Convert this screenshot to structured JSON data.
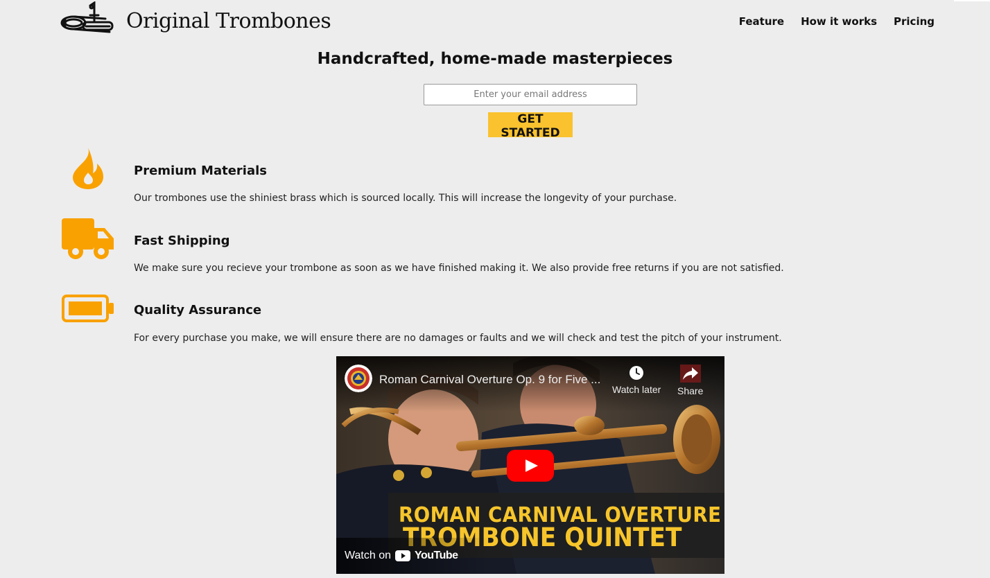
{
  "header": {
    "logo_text": "Original Trombones",
    "nav": [
      {
        "label": "Feature"
      },
      {
        "label": "How it works"
      },
      {
        "label": "Pricing"
      }
    ]
  },
  "hero": {
    "title": "Handcrafted, home-made masterpieces",
    "email_placeholder": "Enter your email address",
    "cta_label": "GET STARTED"
  },
  "features": [
    {
      "icon": "fire-icon",
      "title": "Premium Materials",
      "description": "Our trombones use the shiniest brass which is sourced locally. This will increase the longevity of your purchase."
    },
    {
      "icon": "truck-icon",
      "title": "Fast Shipping",
      "description": "We make sure you recieve your trombone as soon as we have finished making it. We also provide free returns if you are not satisfied."
    },
    {
      "icon": "battery-full-icon",
      "title": "Quality Assurance",
      "description": "For every purchase you make, we will ensure there are no damages or faults and we will check and test the pitch of your instrument."
    }
  ],
  "video": {
    "title": "Roman Carnival Overture Op. 9 for Five ...",
    "watch_later": "Watch later",
    "share": "Share",
    "banner_line1": "ROMAN CARNIVAL OVERTURE",
    "banner_line2": "TROMBONE QUINTET",
    "watch_on": "Watch on",
    "youtube": "YouTube"
  },
  "colors": {
    "accent_orange": "#f9a100",
    "cta_yellow": "#f9c22e",
    "background": "#ededed",
    "youtube_red": "#ff0000"
  }
}
